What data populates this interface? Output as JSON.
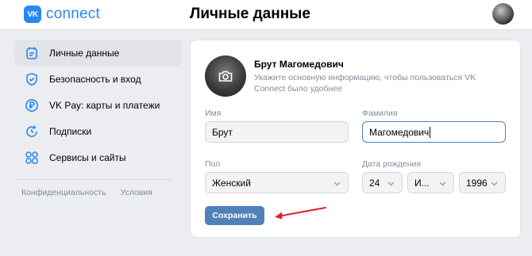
{
  "header": {
    "logo_mark": "VK",
    "logo_text": "connect",
    "title": "Личные данные"
  },
  "sidebar": {
    "items": [
      {
        "label": "Личные данные",
        "icon": "profile-card-icon",
        "active": true
      },
      {
        "label": "Безопасность и вход",
        "icon": "shield-icon",
        "active": false
      },
      {
        "label": "VK Pay: карты и платежи",
        "icon": "ruble-icon",
        "active": false
      },
      {
        "label": "Подписки",
        "icon": "subscription-icon",
        "active": false
      },
      {
        "label": "Сервисы и сайты",
        "icon": "services-grid-icon",
        "active": false
      }
    ],
    "footer": {
      "privacy": "Конфиденциальность",
      "terms": "Условия"
    }
  },
  "profile": {
    "name": "Брут Магомедович",
    "hint": "Укажите основную информацию, чтобы пользоваться VK Connect было удобнее"
  },
  "form": {
    "first_name_label": "Имя",
    "first_name_value": "Брут",
    "last_name_label": "Фамилия",
    "last_name_value": "Магомедович",
    "gender_label": "Пол",
    "gender_value": "Женский",
    "birthdate_label": "Дата рождения",
    "birth_day": "24",
    "birth_month": "И...",
    "birth_year": "1996",
    "save_label": "Сохранить"
  },
  "colors": {
    "accent": "#2787f5",
    "button": "#5181b8",
    "annotation_arrow": "#e0202a"
  }
}
